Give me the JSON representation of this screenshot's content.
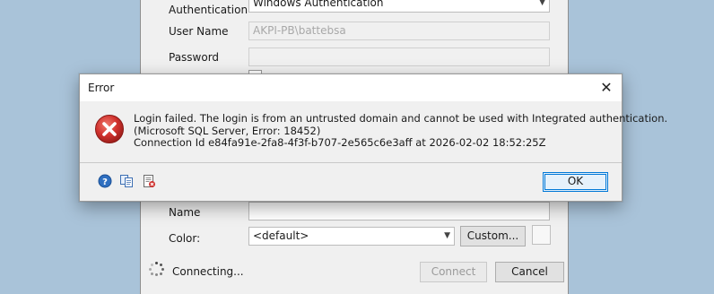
{
  "connect_dialog": {
    "authentication_label": "Authentication",
    "authentication_value": "Windows Authentication",
    "username_label": "User Name",
    "username_value": "AKPI-PB\\battebsa",
    "password_label": "Password",
    "name_label": "Name",
    "name_value": "",
    "color_label": "Color:",
    "color_value": "<default>",
    "custom_button": "Custom...",
    "status_text": "Connecting...",
    "connect_button": "Connect",
    "cancel_button": "Cancel"
  },
  "error_dialog": {
    "title": "Error",
    "close_glyph": "✕",
    "message": "Login failed. The login is from an untrusted domain and cannot be used with Integrated authentication.\n(Microsoft SQL Server, Error: 18452)\nConnection Id e84fa91e-2fa8-4f3f-b707-2e565c6e3aff at 2026-02-02 18:52:25Z",
    "ok_button": "OK",
    "footer_icons": [
      "help-icon",
      "copy-icon",
      "show-details-icon"
    ]
  },
  "colors": {
    "desktop": "#a9c3d9",
    "dialog": "#f0f0f0",
    "error_red": "#d0312d",
    "accent": "#0078d7"
  }
}
